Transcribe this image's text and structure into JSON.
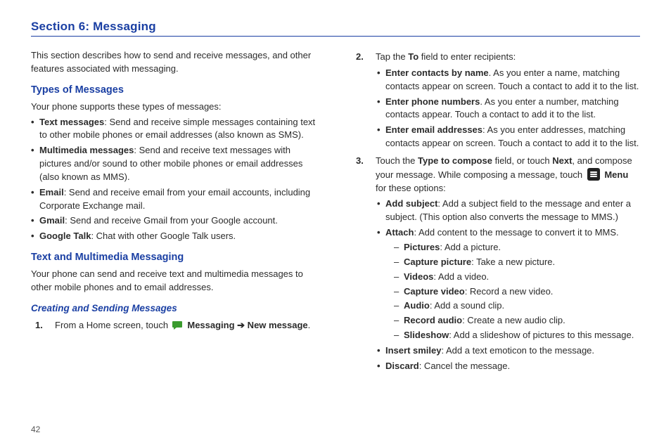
{
  "pageNumber": "42",
  "sectionTitle": "Section 6: Messaging",
  "col1": {
    "intro": "This section describes how to send and receive messages, and other features associated with messaging.",
    "typesHeading": "Types of Messages",
    "supportsLine": "Your phone supports these types of messages:",
    "types": [
      {
        "b": "Text messages",
        "t": ": Send and receive simple messages containing text to other mobile phones or email addresses (also known as SMS)."
      },
      {
        "b": "Multimedia messages",
        "t": ": Send and receive text messages with pictures and/or sound to other mobile phones or email addresses (also known as MMS)."
      },
      {
        "b": "Email",
        "t": ": Send and receive email from your email accounts, including Corporate Exchange mail."
      },
      {
        "b": "Gmail",
        "t": ": Send and receive Gmail from your Google account."
      },
      {
        "b": "Google Talk",
        "t": ": Chat with other Google Talk users."
      }
    ],
    "textMultiHeading": "Text and Multimedia Messaging",
    "textMultiIntro": "Your phone can send and receive text and multimedia messages to other mobile phones and to email addresses.",
    "creatingHeading": "Creating and Sending Messages",
    "step1_a": "From a Home screen, touch ",
    "step1_b": " Messaging ",
    "step1_c": " New message",
    "step1_end": "."
  },
  "col2": {
    "step2_lead": "Tap the ",
    "step2_to": "To",
    "step2_tail": " field to enter recipients:",
    "step2_items": [
      {
        "b": "Enter contacts by name",
        "t": ". As you enter a name, matching contacts appear on screen. Touch a contact to add it to the list."
      },
      {
        "b": "Enter phone numbers",
        "t": ". As you enter a number, matching contacts appear. Touch a contact to add it to the list."
      },
      {
        "b": "Enter email addresses",
        "t": ": As you enter addresses, matching contacts appear on screen. Touch a contact to add it to the list."
      }
    ],
    "step3_a": "Touch the ",
    "step3_b": "Type to compose",
    "step3_c": " field, or touch ",
    "step3_d": "Next",
    "step3_e": ", and compose your message. While composing a message, touch ",
    "step3_menu": " Menu",
    "step3_f": " for these options:",
    "addSubject_b": "Add subject",
    "addSubject_t": ": Add a subject field to the message and enter a subject. (This option also converts the message to MMS.)",
    "attach_b": "Attach",
    "attach_t": ": Add content to the message to convert it to MMS.",
    "attach_items": [
      {
        "b": "Pictures",
        "t": ": Add a picture."
      },
      {
        "b": "Capture picture",
        "t": ": Take a new picture."
      },
      {
        "b": "Videos",
        "t": ": Add a video."
      },
      {
        "b": "Capture video",
        "t": ": Record a new video."
      },
      {
        "b": "Audio",
        "t": ": Add a sound clip."
      },
      {
        "b": "Record audio",
        "t": ": Create a new audio clip."
      },
      {
        "b": "Slideshow",
        "t": ": Add a slideshow of pictures to this message."
      }
    ],
    "insertSmiley_b": "Insert smiley",
    "insertSmiley_t": ": Add a text emoticon to the message.",
    "discard_b": "Discard",
    "discard_t": ": Cancel the message."
  }
}
